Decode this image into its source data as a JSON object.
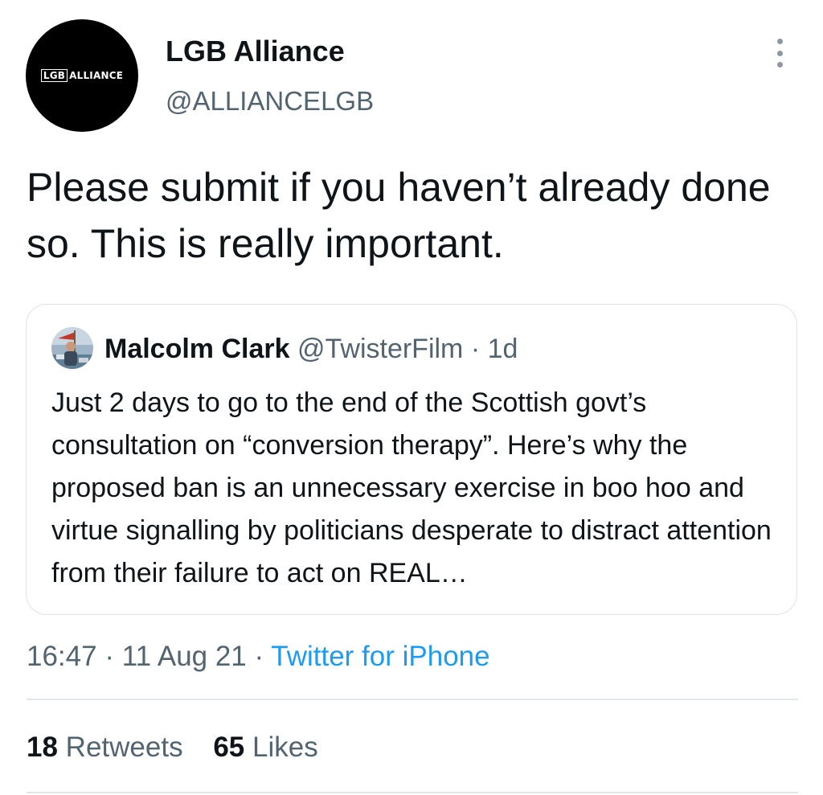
{
  "author": {
    "logo_box_text": "LGB",
    "logo_text": "ALLIANCE",
    "display_name": "LGB Alliance",
    "handle": "@ALLIANCELGB"
  },
  "tweet": {
    "text": "Please submit if you haven’t already done so. This is really important."
  },
  "quoted_tweet": {
    "display_name": "Malcolm Clark",
    "handle": "@TwisterFilm",
    "separator": "·",
    "time": "1d",
    "text": "Just 2 days to go to the end of the Scottish govt’s consultation on “conversion therapy”. Here’s why the proposed ban is an unnecessary exercise in boo hoo and virtue signalling by politicians desperate to distract attention from their failure to act on REAL…"
  },
  "meta": {
    "time": "16:47",
    "date": "11 Aug 21",
    "separator": "·",
    "source": "Twitter for iPhone"
  },
  "stats": {
    "retweets_count": "18",
    "retweets_label": "Retweets",
    "likes_count": "65",
    "likes_label": "Likes"
  },
  "colors": {
    "text_primary": "#0f1419",
    "text_secondary": "#536471",
    "link": "#1d9bf0",
    "border": "#dfe3e7"
  },
  "icons": {
    "more": "more-vertical-icon"
  }
}
